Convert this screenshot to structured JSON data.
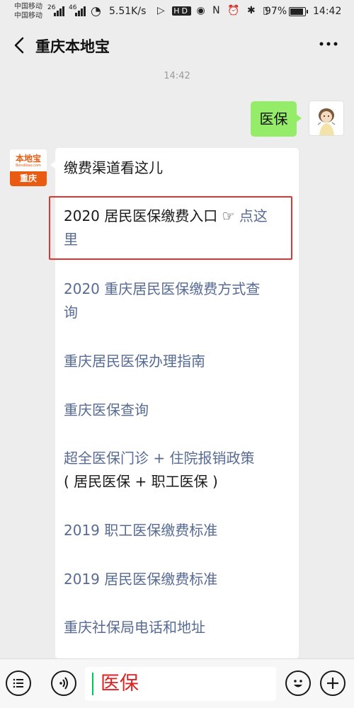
{
  "status_bar": {
    "carrier_1": "中国移动",
    "carrier_2": "中国移动",
    "signal_1_label": "26",
    "signal_2_label": "46",
    "net_speed": "5.51K/s",
    "hd_label": "HD",
    "battery_percent": "97%",
    "battery_level": 0.97,
    "time": "14:42"
  },
  "header": {
    "back_icon": "chevron-left-icon",
    "title": "重庆本地宝",
    "more_icon": "more-dots-icon"
  },
  "chat": {
    "timestamp": "14:42",
    "user_message": "医保",
    "bot_avatar": {
      "logo_text": "本地宝",
      "logo_sub": "Bendibao.com",
      "city": "重庆"
    },
    "bot_message": {
      "heading": "缴费渠道看这儿",
      "links": [
        {
          "line1": "2020 居民医保缴费入口 ☞ ",
          "line1_tail": "点这",
          "line2": "里"
        },
        {
          "line1": "2020 重庆居民医保缴费方式查",
          "line2": "询"
        },
        {
          "line1": "重庆居民医保办理指南"
        },
        {
          "line1": "重庆医保查询"
        },
        {
          "line1": "超全医保门诊 + 住院报销政策",
          "line2": "( 居民医保 + 职工医保 )"
        },
        {
          "line1": "2019 职工医保缴费标准"
        },
        {
          "line1": "2019 居民医保缴费标准"
        },
        {
          "line1": "重庆社保局电话和地址"
        }
      ]
    }
  },
  "input_bar": {
    "input_value": "医保",
    "icons": [
      "menu-list-icon",
      "voice-icon",
      "emoji-icon",
      "plus-icon"
    ]
  },
  "colors": {
    "background": "#ededed",
    "user_bubble": "#95ec69",
    "link": "#576b95",
    "highlight_border": "#e3342f",
    "input_text": "#e02020",
    "brand_orange": "#e95b10"
  }
}
